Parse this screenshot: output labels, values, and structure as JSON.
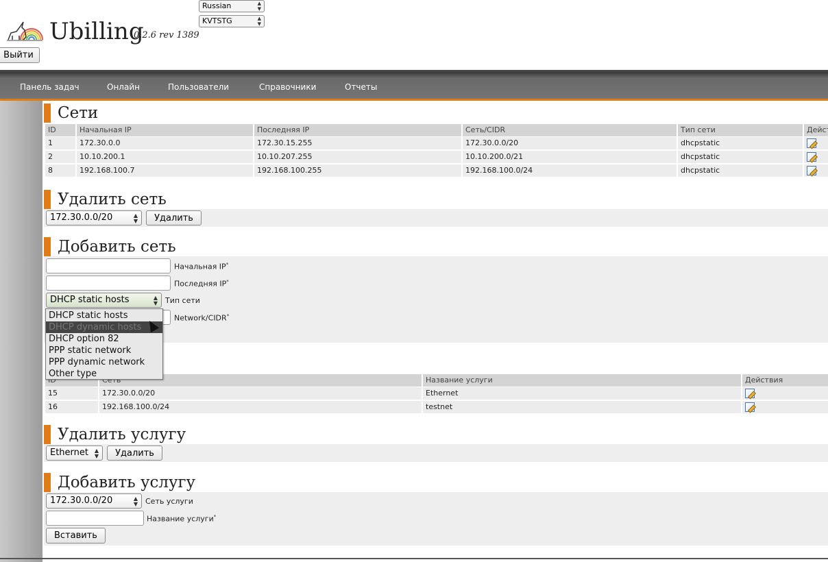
{
  "header": {
    "app_title": "Ubilling",
    "version": "0.2.6 rev 1389",
    "language": "Russian",
    "server": "KVTSTG",
    "logout_label": "Выйти"
  },
  "nav": {
    "items": [
      "Панель задач",
      "Онлайн",
      "Пользователи",
      "Справочники",
      "Отчеты"
    ]
  },
  "networks": {
    "title": "Сети",
    "columns": [
      "ID",
      "Начальная IP",
      "Последняя IP",
      "Сеть/CIDR",
      "Тип сети",
      "Дейст"
    ],
    "rows": [
      {
        "id": "1",
        "start": "172.30.0.0",
        "end": "172.30.15.255",
        "cidr": "172.30.0.0/20",
        "type": "dhcpstatic"
      },
      {
        "id": "2",
        "start": "10.10.200.1",
        "end": "10.10.207.255",
        "cidr": "10.10.200.0/21",
        "type": "dhcpstatic"
      },
      {
        "id": "8",
        "start": "192.168.100.7",
        "end": "192.168.100.255",
        "cidr": "192.168.100.0/24",
        "type": "dhcpstatic"
      }
    ]
  },
  "delete_network": {
    "title": "Удалить сеть",
    "selected": "172.30.0.0/20",
    "button_label": "Удалить"
  },
  "add_network": {
    "title": "Добавить сеть",
    "start_ip_label": "Начальная IP",
    "end_ip_label": "Последняя IP",
    "type_label": "Тип сети",
    "cidr_label": "Network/CIDR",
    "required_mark": "*",
    "type_selected": "DHCP static hosts",
    "type_options": [
      "DHCP static hosts",
      "DHCP dynamic hosts",
      "DHCP option 82",
      "PPP static network",
      "PPP dynamic network",
      "Other type"
    ],
    "highlighted_option": 1
  },
  "services": {
    "columns": [
      "ID",
      "Сеть",
      "Название услуги",
      "Действия"
    ],
    "rows": [
      {
        "id": "15",
        "network": "172.30.0.0/20",
        "name": "Ethernet"
      },
      {
        "id": "16",
        "network": "192.168.100.0/24",
        "name": "testnet"
      }
    ]
  },
  "delete_service": {
    "title": "Удалить услугу",
    "selected": "Ethernet",
    "button_label": "Удалить"
  },
  "add_service": {
    "title": "Добавить услугу",
    "network_selected": "172.30.0.0/20",
    "network_label": "Сеть услуги",
    "name_label": "Название услуги",
    "required_mark": "*",
    "button_label": "Вставить"
  },
  "colors": {
    "accent": "#e07b1a",
    "navbar": "#6a6a6a"
  },
  "icons": {
    "logo": "unicorn-rainbow-logo",
    "edit": "edit-pencil-icon"
  }
}
